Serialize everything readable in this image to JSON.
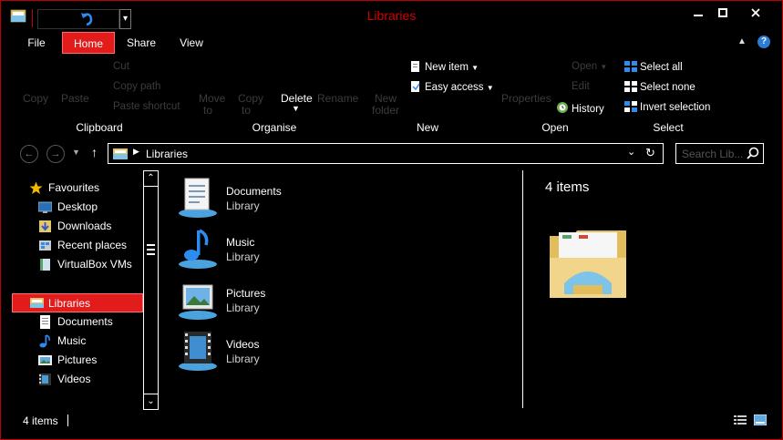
{
  "window": {
    "title": "Libraries",
    "accent_color": "#e21b1b",
    "title_color": "#d40000",
    "minimize_icon": "minimize-icon",
    "maximize_icon": "maximize-icon",
    "close_icon": "close-icon"
  },
  "quick_access": {
    "undo_icon": "undo-icon",
    "dropdown_glyph": "▾"
  },
  "ribbon_tabs": [
    {
      "label": "File",
      "active": false
    },
    {
      "label": "Home",
      "active": true
    },
    {
      "label": "Share",
      "active": false
    },
    {
      "label": "View",
      "active": false
    }
  ],
  "ribbon": {
    "clipboard": {
      "copy": "Copy",
      "paste": "Paste",
      "cut": "Cut",
      "copy_path": "Copy path",
      "paste_shortcut": "Paste shortcut",
      "label": "Clipboard"
    },
    "organise": {
      "move_to_1": "Move",
      "move_to_2": "to",
      "copy_to_1": "Copy",
      "copy_to_2": "to",
      "delete": "Delete",
      "rename": "Rename",
      "label": "Organise"
    },
    "new": {
      "new_folder_1": "New",
      "new_folder_2": "folder",
      "new_item": "New item",
      "easy_access": "Easy access",
      "label": "New"
    },
    "open": {
      "properties": "Properties",
      "open": "Open",
      "edit": "Edit",
      "history": "History",
      "label": "Open"
    },
    "select": {
      "select_all": "Select all",
      "select_none": "Select none",
      "invert_selection": "Invert selection",
      "label": "Select"
    }
  },
  "address": {
    "path": "Libraries",
    "search_placeholder": "Search Lib..."
  },
  "nav_pane": {
    "items": [
      {
        "label": "Favourites",
        "icon": "star-icon"
      },
      {
        "label": "Desktop",
        "icon": "desktop-icon"
      },
      {
        "label": "Downloads",
        "icon": "downloads-icon"
      },
      {
        "label": "Recent places",
        "icon": "recent-places-icon"
      },
      {
        "label": "VirtualBox VMs",
        "icon": "folder-icon"
      },
      {
        "label": "Libraries",
        "icon": "libraries-icon",
        "selected": true
      },
      {
        "label": "Documents",
        "icon": "documents-icon"
      },
      {
        "label": "Music",
        "icon": "music-icon"
      },
      {
        "label": "Pictures",
        "icon": "pictures-icon"
      },
      {
        "label": "Videos",
        "icon": "videos-icon"
      }
    ]
  },
  "content": {
    "items": [
      {
        "name": "Documents",
        "type": "Library",
        "icon": "documents-library-icon"
      },
      {
        "name": "Music",
        "type": "Library",
        "icon": "music-library-icon"
      },
      {
        "name": "Pictures",
        "type": "Library",
        "icon": "pictures-library-icon"
      },
      {
        "name": "Videos",
        "type": "Library",
        "icon": "videos-library-icon"
      }
    ]
  },
  "details": {
    "count": "4 items"
  },
  "status": {
    "count": "4 items"
  }
}
